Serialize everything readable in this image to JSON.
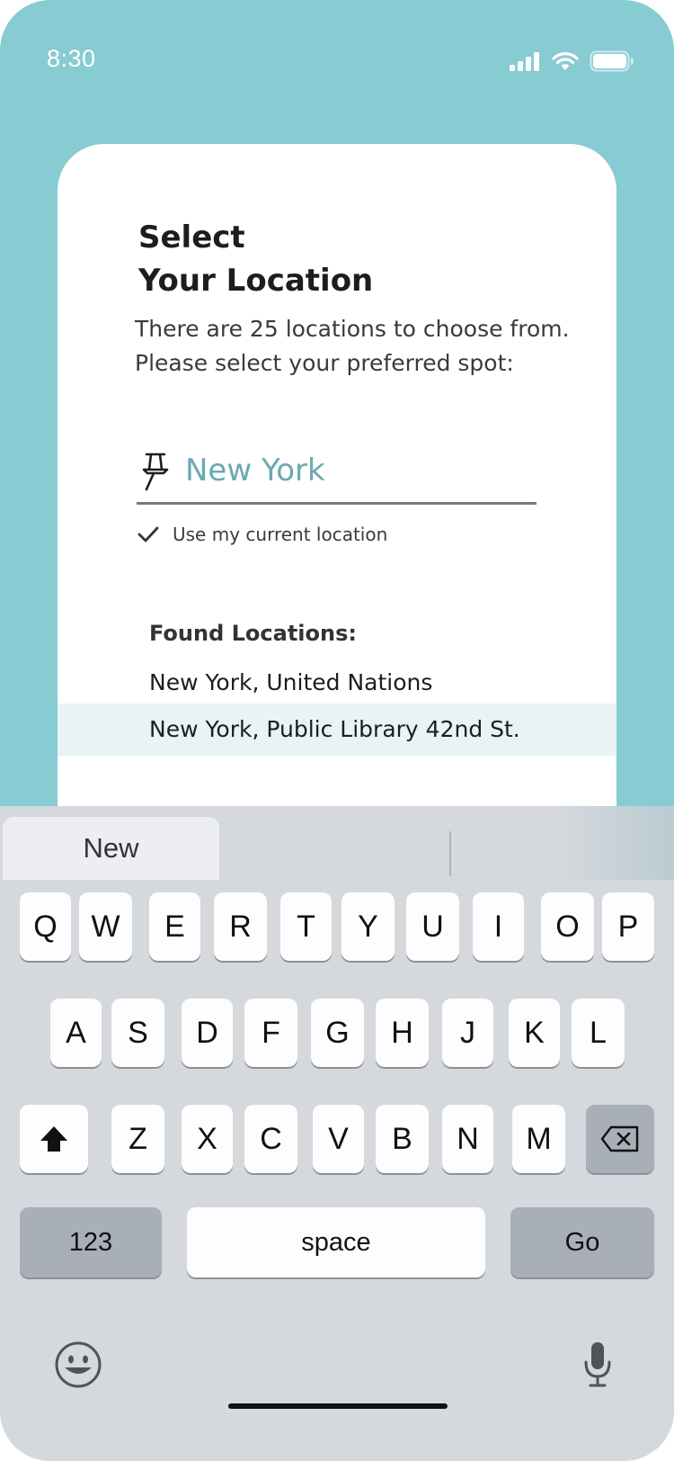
{
  "status_bar": {
    "time": "8:30",
    "icons": [
      "signal-icon",
      "wifi-icon",
      "battery-icon"
    ]
  },
  "colors": {
    "background": "#87cbd3",
    "card": "#ffffff",
    "input_text": "#6aa9b2",
    "selected_row": "#e8f4f4",
    "keyboard": "#d5d8dc",
    "special_key": "#a8afb8"
  },
  "page": {
    "title_line1": "Select",
    "title_line2": "Your Location",
    "subtitle_line1": "There are 25 locations to choose from.",
    "subtitle_line2": "Please select your preferred spot:"
  },
  "search": {
    "value": "New York",
    "icon": "pushpin-icon"
  },
  "use_current_location": {
    "label": "Use my current location",
    "checked": true
  },
  "results": {
    "header": "Found Locations:",
    "items": [
      {
        "label": "New York, United Nations",
        "selected": false
      },
      {
        "label": "New York, Public Library 42nd St.",
        "selected": true
      }
    ]
  },
  "keyboard": {
    "suggestion": "New",
    "row1": [
      "Q",
      "W",
      "E",
      "R",
      "T",
      "Y",
      "U",
      "I",
      "O",
      "P"
    ],
    "row2": [
      "A",
      "S",
      "D",
      "F",
      "G",
      "H",
      "J",
      "K",
      "L"
    ],
    "row3": [
      "Z",
      "X",
      "C",
      "V",
      "B",
      "N",
      "M"
    ],
    "numbers_label": "123",
    "space_label": "space",
    "go_label": "Go",
    "shift_icon": "shift-icon",
    "delete_icon": "delete-icon",
    "emoji_icon": "emoji-icon",
    "mic_icon": "microphone-icon"
  }
}
